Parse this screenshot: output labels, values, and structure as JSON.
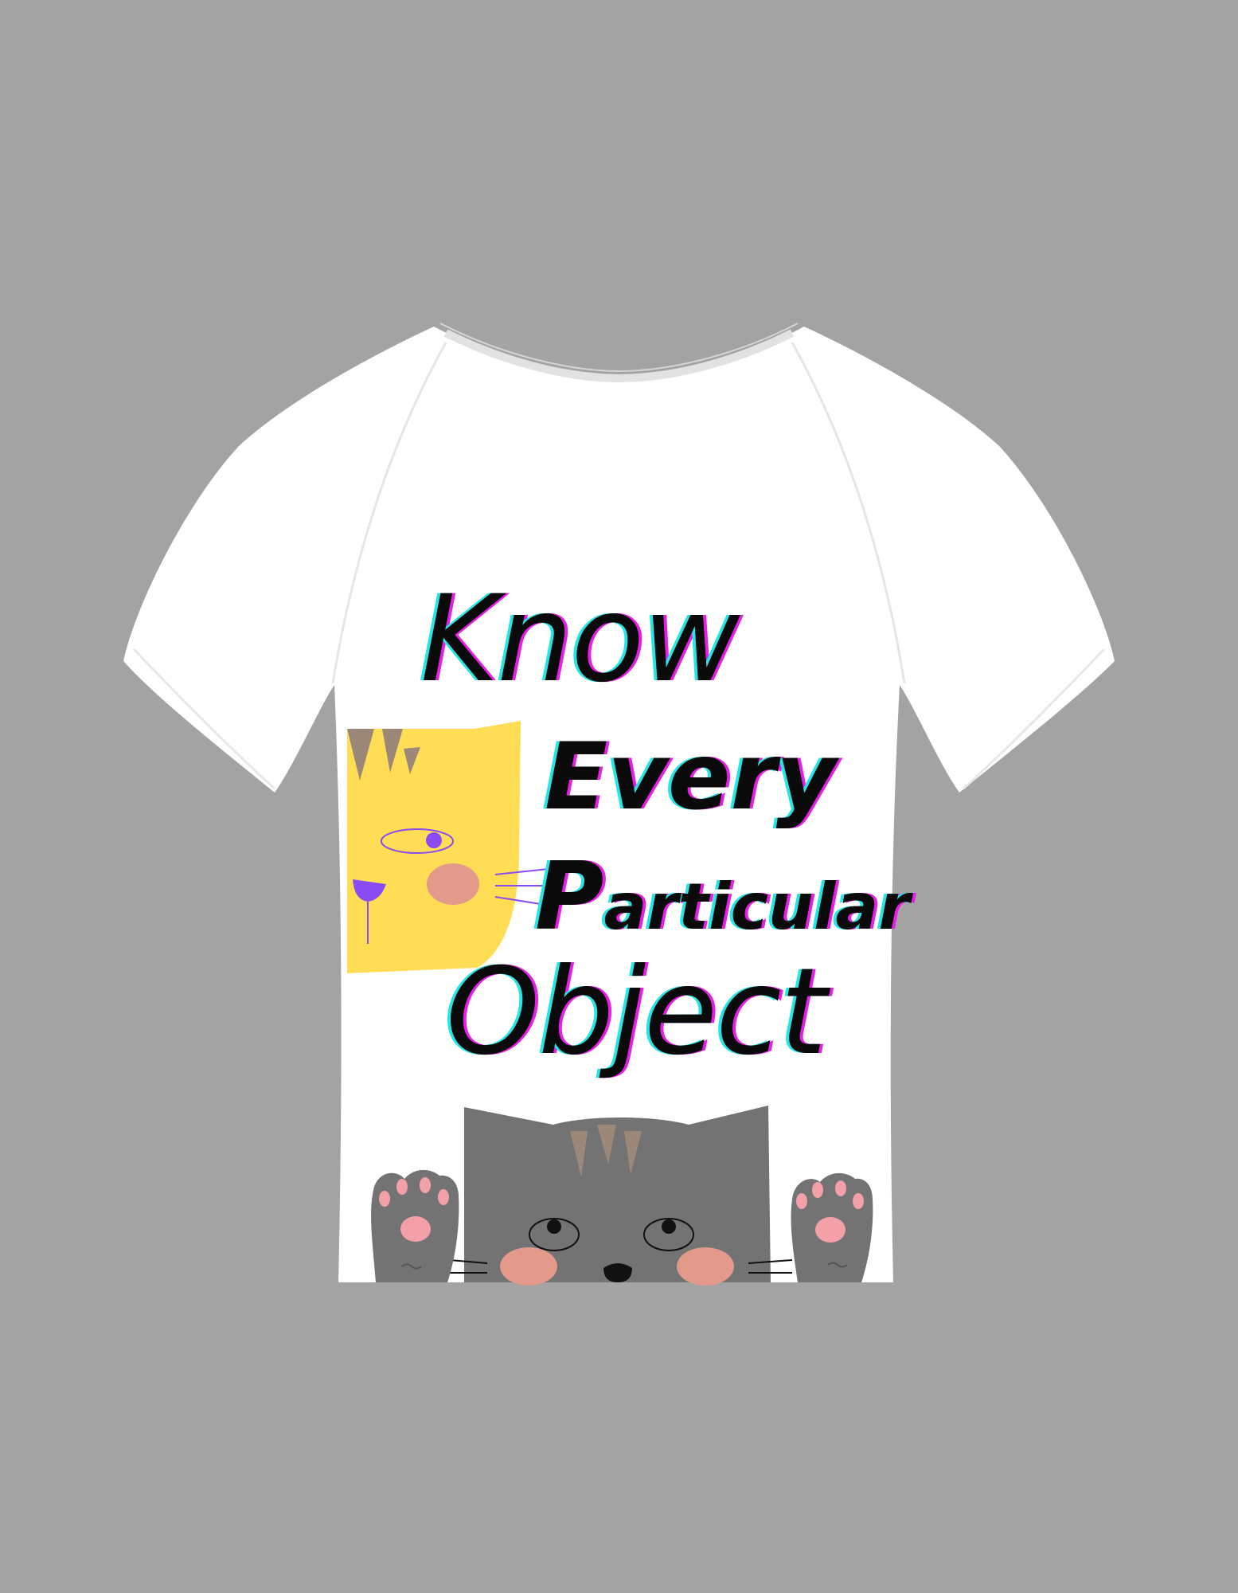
{
  "shirt": {
    "color": "#ffffff",
    "background": "#a3a3a3"
  },
  "slogan": {
    "line1": "Know",
    "line2": "Every",
    "line3_initial": "P",
    "line3_rest": "articular",
    "line4": "Object"
  },
  "colors": {
    "text": "#0a0a0a",
    "glitch_cyan": "#25e6e6",
    "glitch_magenta": "#e61ee6",
    "yellow_cat": "#ffdd55",
    "gray_cat": "#737373",
    "paw_pink": "#f4a0a8",
    "cheek": "#e39a8a",
    "stripe": "#9c8878",
    "purple": "#8a4cf2"
  },
  "illustrations": {
    "yellow_cat": "yellow-cat-face-icon",
    "gray_cat": "peeking-gray-cat-icon",
    "paws": "cat-paw-icon"
  }
}
